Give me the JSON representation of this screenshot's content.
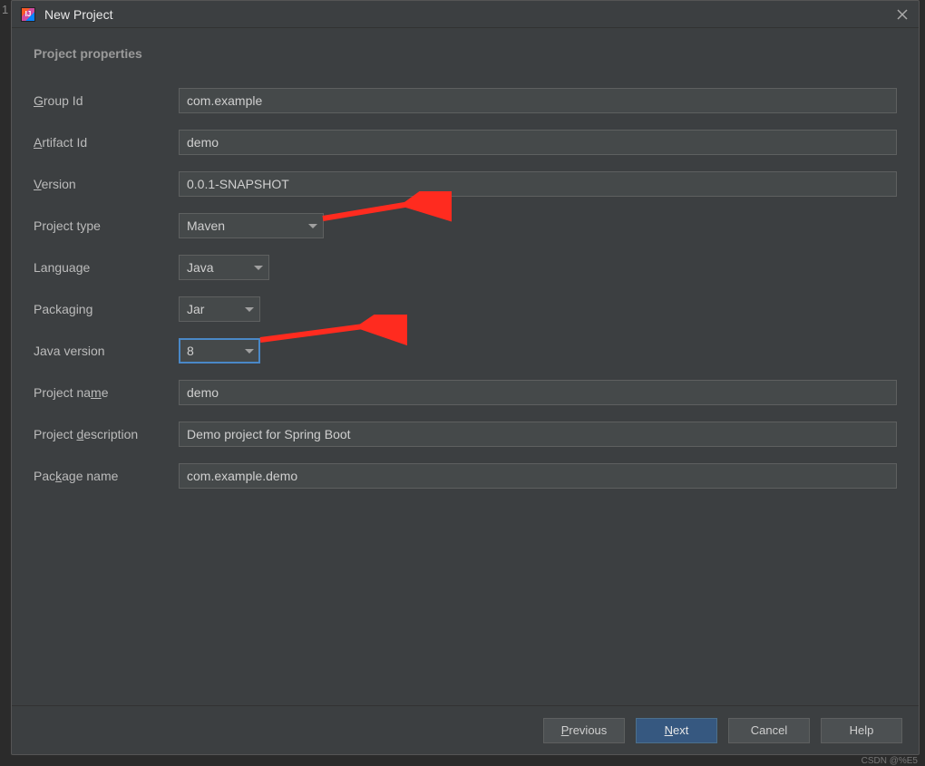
{
  "gutter": "1",
  "window": {
    "title": "New Project"
  },
  "section": {
    "title": "Project properties"
  },
  "form": {
    "group_id": {
      "label_pre": "",
      "label_u": "G",
      "label_post": "roup Id",
      "value": "com.example"
    },
    "artifact_id": {
      "label_pre": "",
      "label_u": "A",
      "label_post": "rtifact Id",
      "value": "demo"
    },
    "version": {
      "label_pre": "",
      "label_u": "V",
      "label_post": "ersion",
      "value": "0.0.1-SNAPSHOT"
    },
    "project_type": {
      "label": "Project type",
      "value": "Maven"
    },
    "language": {
      "label": "Language",
      "value": "Java"
    },
    "packaging": {
      "label": "Packaging",
      "value": "Jar"
    },
    "java_version": {
      "label": "Java version",
      "value": "8"
    },
    "project_name": {
      "label_pre": "Project na",
      "label_u": "m",
      "label_post": "e",
      "value": "demo"
    },
    "project_description": {
      "label_pre": "Project ",
      "label_u": "d",
      "label_post": "escription",
      "value": "Demo project for Spring Boot"
    },
    "package_name": {
      "label_pre": "Pac",
      "label_u": "k",
      "label_post": "age name",
      "value": "com.example.demo"
    }
  },
  "buttons": {
    "previous": {
      "pre": "",
      "u": "P",
      "post": "revious"
    },
    "next": {
      "pre": "",
      "u": "N",
      "post": "ext"
    },
    "cancel": "Cancel",
    "help": "Help"
  },
  "watermark": "CSDN @%E5"
}
